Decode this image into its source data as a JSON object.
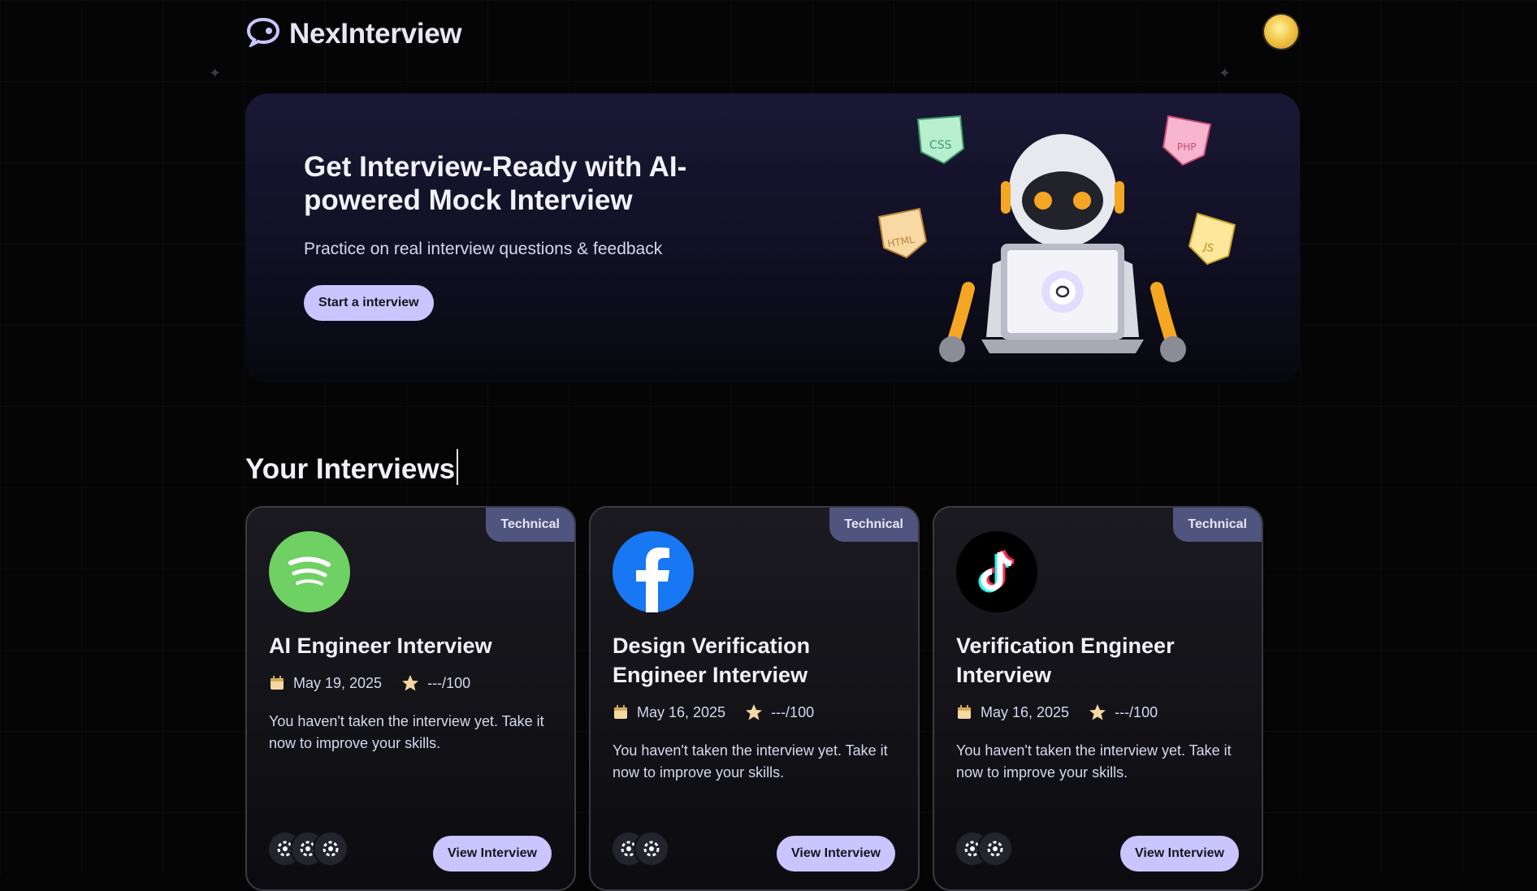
{
  "brand": {
    "name": "NexInterview",
    "icon": "chat-bubble-logo"
  },
  "user": {
    "avatar_icon": "gold-avatar"
  },
  "hero": {
    "title": "Get Interview-Ready with AI-powered Mock Interview",
    "subtitle": "Practice on real interview questions & feedback",
    "cta_label": "Start a interview",
    "illustration": {
      "robot_icon": "robot-laptop",
      "tags": [
        "CSS",
        "PHP",
        "HTML",
        "JS"
      ]
    }
  },
  "section": {
    "title": "Your Interviews"
  },
  "colors": {
    "accent": "#cac5fe",
    "badge": "#4f557f",
    "background": "#050506"
  },
  "interviews": [
    {
      "badge": "Technical",
      "logo_icon": "spotify-icon",
      "title": "AI Engineer Interview",
      "date": "May 19, 2025",
      "score": "---/100",
      "description": "You haven't taken the interview yet. Take it now to improve your skills.",
      "tech_icons": [
        "tech-icon",
        "tech-icon",
        "tech-icon"
      ],
      "action_label": "View Interview"
    },
    {
      "badge": "Technical",
      "logo_icon": "facebook-icon",
      "title": "Design Verification Engineer Interview",
      "date": "May 16, 2025",
      "score": "---/100",
      "description": "You haven't taken the interview yet. Take it now to improve your skills.",
      "tech_icons": [
        "tech-icon",
        "tech-icon"
      ],
      "action_label": "View Interview"
    },
    {
      "badge": "Technical",
      "logo_icon": "tiktok-icon",
      "title": "Verification Engineer Interview",
      "date": "May 16, 2025",
      "score": "---/100",
      "description": "You haven't taken the interview yet. Take it now to improve your skills.",
      "tech_icons": [
        "tech-icon",
        "tech-icon"
      ],
      "action_label": "View Interview"
    }
  ]
}
